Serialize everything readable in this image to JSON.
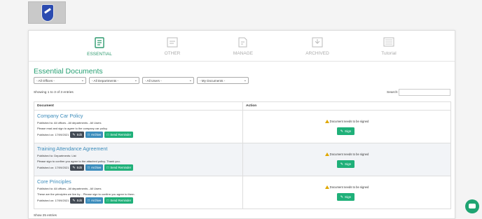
{
  "tabs": [
    {
      "label": "ESSENTIAL",
      "icon": "document-check-icon",
      "active": true
    },
    {
      "label": "OTHER",
      "icon": "folder-document-icon",
      "active": false
    },
    {
      "label": "MANAGE",
      "icon": "document-edit-icon",
      "active": false
    },
    {
      "label": "ARCHIVED",
      "icon": "archive-folder-icon",
      "active": false
    },
    {
      "label": "Tutorial",
      "icon": "tutorial-icon",
      "active": false
    }
  ],
  "section_title": "Essential Documents",
  "filters": [
    "- All Offices -",
    "- All Departments -",
    "- All Users -",
    "- My Documents -"
  ],
  "entries_info": "Showing 1 to 3 of 3 entries",
  "search_label": "Search:",
  "table": {
    "headers": [
      "Document",
      "Action"
    ],
    "rows": [
      {
        "title": "Company Car Policy",
        "published_to": "Published to: All offices - All departments - All Users",
        "description": "Please read and sign to agree to the company car policy.",
        "published_on": "Published on:  17/09/2021",
        "status": "Document needs to be signed"
      },
      {
        "title": "Training Attendance Agreement",
        "published_to": "Published to: Departments: List",
        "description": "Please sign to confirm you agree to the attached policy. Thank you.",
        "published_on": "Published on:  17/09/2021",
        "status": "Document needs to be signed"
      },
      {
        "title": "Core Principles",
        "published_to": "Published to: All offices - All departments - All Users",
        "description": "These are the principles we live by. - Please sign to confirm you agree to them.",
        "published_on": "Published on:  17/09/2021",
        "status": "Document needs to be signed"
      }
    ]
  },
  "buttons": {
    "edit": "Edit",
    "archive": "Archive",
    "reminder": "Send Reminder",
    "sign": "Sign"
  },
  "footer_show": "Show   25   entries",
  "colors": {
    "accent": "#27a073",
    "link": "#3b8bba",
    "dark_button": "#434b55",
    "blue_button": "#3c8dbc"
  }
}
